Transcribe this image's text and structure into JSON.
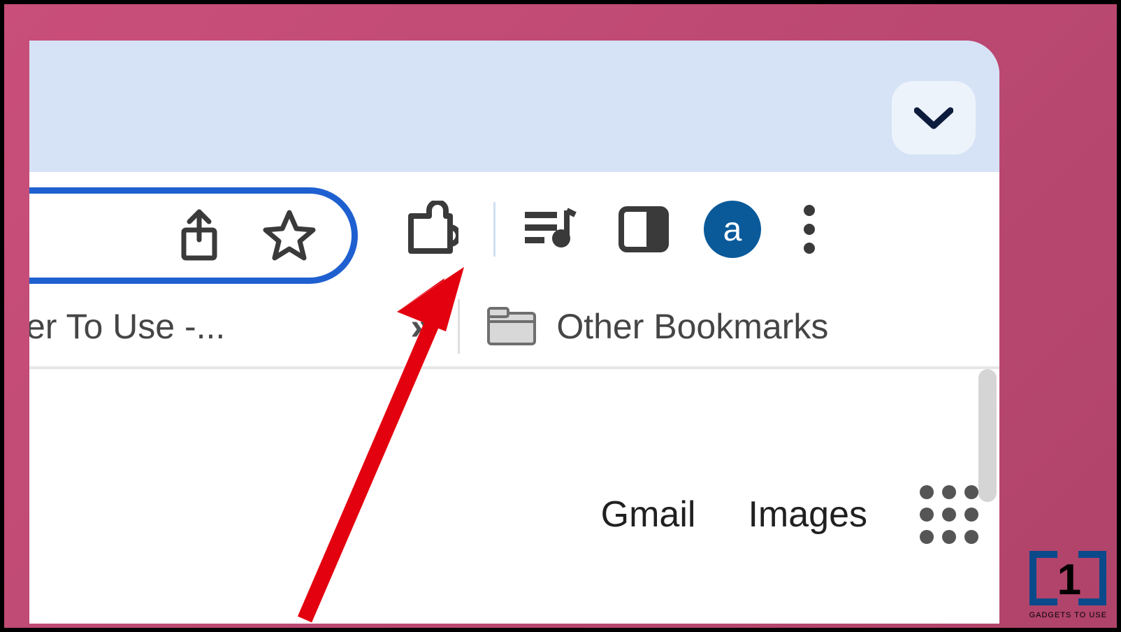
{
  "tab_strip": {
    "dropdown_title": "Search tabs"
  },
  "toolbar": {
    "share_title": "Share",
    "bookmark_title": "Bookmark this tab",
    "extensions_title": "Extensions",
    "media_title": "Control your music, videos and more",
    "sidepanel_title": "Side panel",
    "profile_initial": "a",
    "menu_title": "Customize and control Google Chrome"
  },
  "bookmarks": {
    "truncated_item": "ser To Use -...",
    "overflow_symbol": "»",
    "other_label": "Other Bookmarks"
  },
  "content": {
    "gmail": "Gmail",
    "images": "Images",
    "apps_title": "Google apps"
  },
  "watermark": {
    "text": "GADGETS TO USE"
  }
}
